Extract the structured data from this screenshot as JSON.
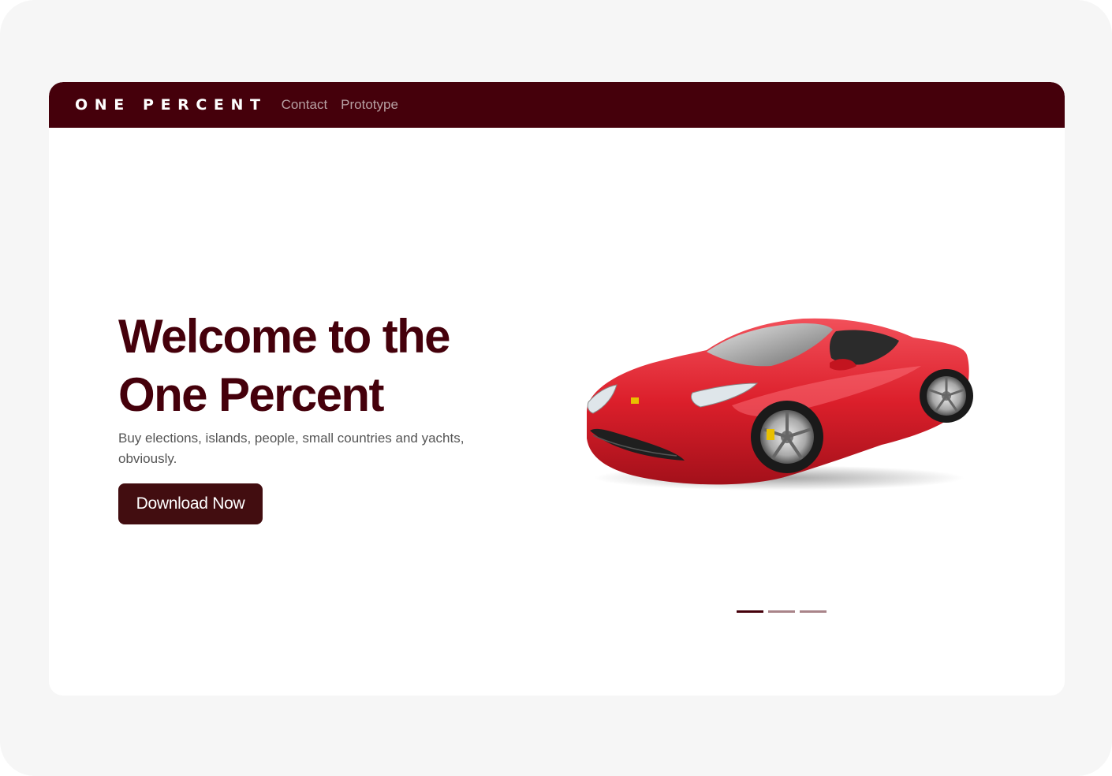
{
  "navbar": {
    "brand": "ONE PERCENT",
    "links": [
      {
        "label": "Contact"
      },
      {
        "label": "Prototype"
      }
    ]
  },
  "hero": {
    "title_line1": "Welcome to the",
    "title_line2": "One Percent",
    "subtitle": "Buy elections, islands, people, small countries and yachts, obviously.",
    "cta_label": "Download Now",
    "image": "red-sports-car"
  },
  "carousel": {
    "slides": 3,
    "active_index": 0
  },
  "colors": {
    "brand": "#45000b",
    "button": "#420d10",
    "nav_link": "#b7a0a3",
    "indicator_inactive": "#a98489"
  }
}
